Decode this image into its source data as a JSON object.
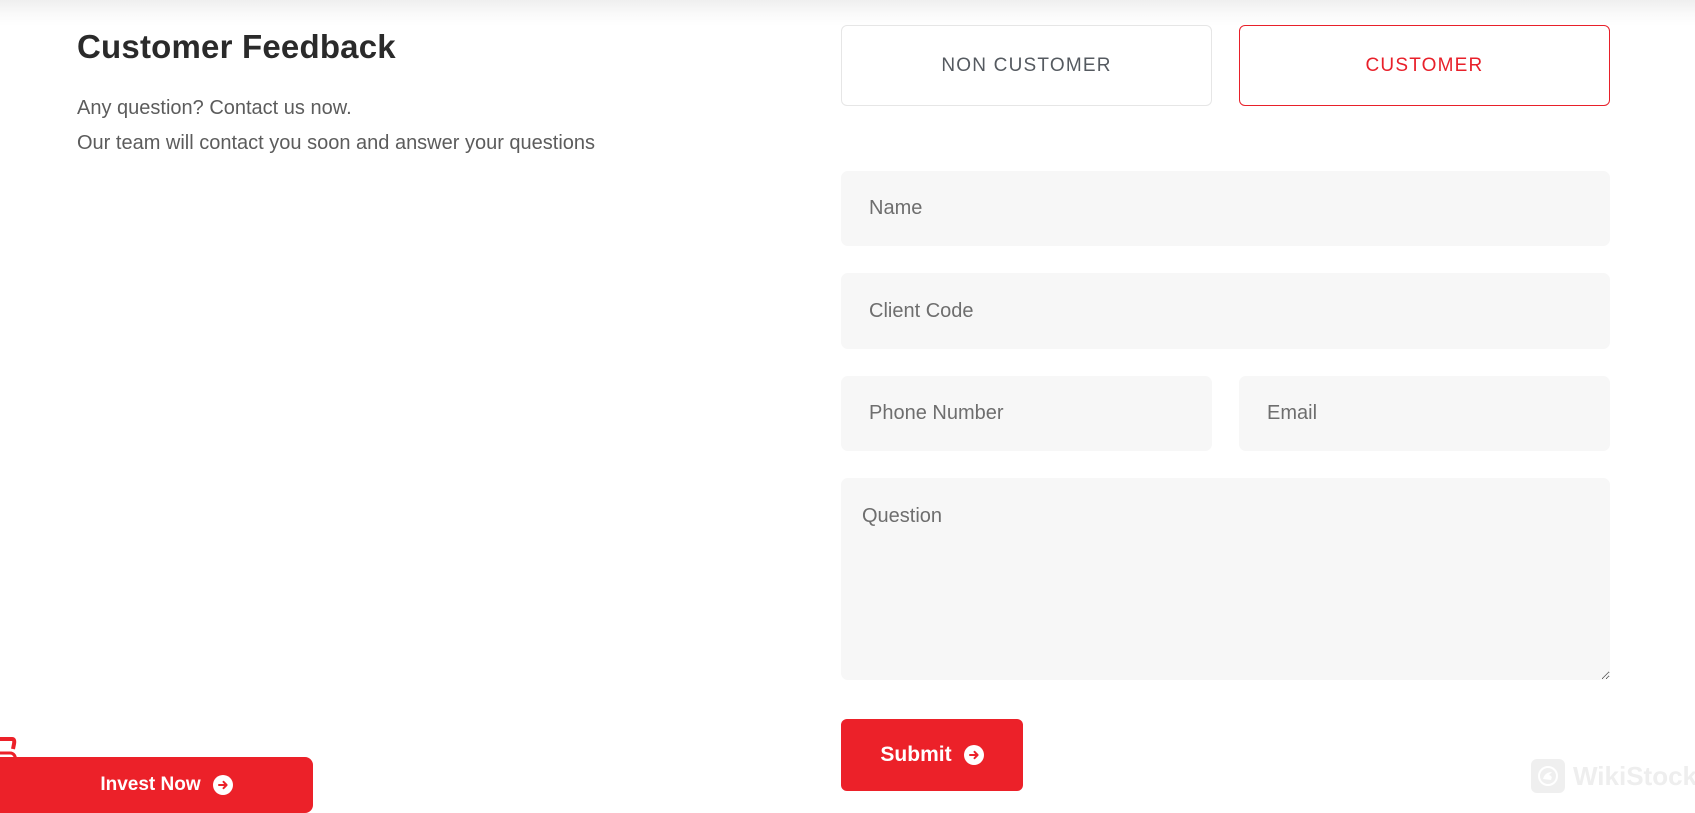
{
  "header": {
    "title": "Customer Feedback",
    "intro_lines": [
      "Any question? Contact us now.",
      "Our team will contact you soon and answer your questions"
    ]
  },
  "tabs": [
    {
      "label": "NON CUSTOMER",
      "active": false
    },
    {
      "label": "CUSTOMER",
      "active": true
    }
  ],
  "form": {
    "name": {
      "placeholder": "Name",
      "value": ""
    },
    "client_code": {
      "placeholder": "Client Code",
      "value": ""
    },
    "phone": {
      "placeholder": "Phone Number",
      "value": ""
    },
    "email": {
      "placeholder": "Email",
      "value": ""
    },
    "question": {
      "placeholder": "Question",
      "value": ""
    },
    "submit_label": "Submit",
    "submit_icon": "circle-arrow-right-icon"
  },
  "floating": {
    "invest_label": "Invest Now",
    "invest_icon": "circle-arrow-right-icon"
  },
  "watermark": {
    "text": "WikiStock",
    "icon": "eagle-logo-icon"
  },
  "colors": {
    "accent": "#ec2129",
    "field_bg": "#f7f7f7",
    "title": "#2a2a2a",
    "body_text": "#5c5c5c"
  }
}
